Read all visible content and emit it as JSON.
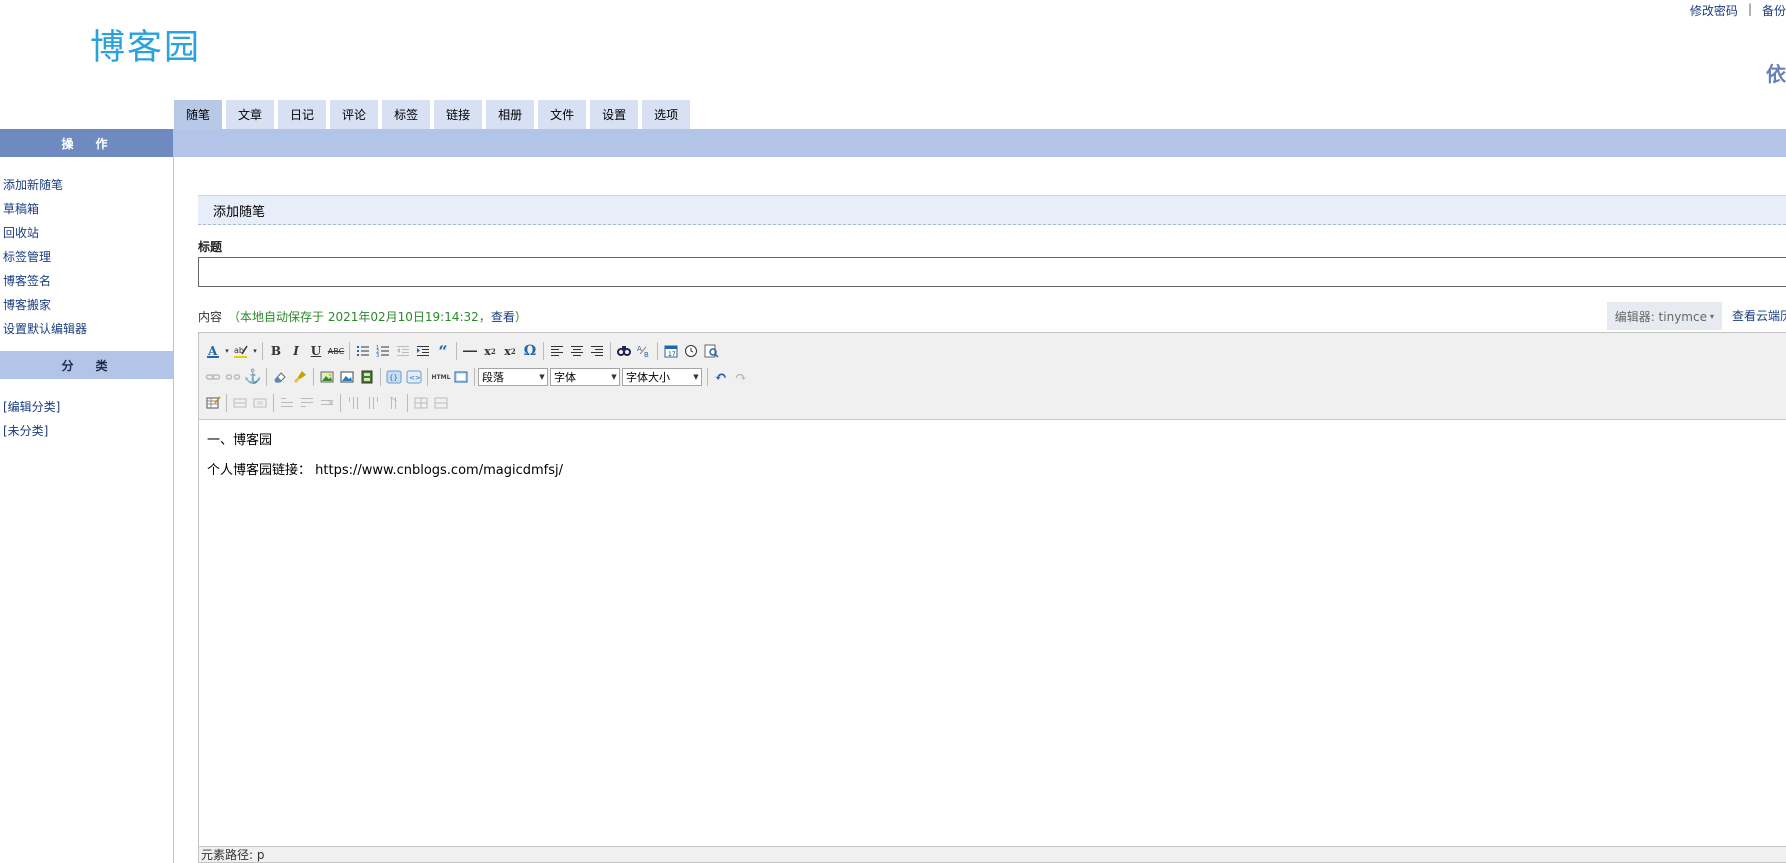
{
  "header": {
    "logo_text": "博客园",
    "top_links": [
      "修改密码",
      "备份"
    ],
    "top_sep": "|",
    "user_char": "依"
  },
  "tabs": [
    {
      "label": "随笔",
      "active": true
    },
    {
      "label": "文章"
    },
    {
      "label": "日记"
    },
    {
      "label": "评论"
    },
    {
      "label": "标签"
    },
    {
      "label": "链接"
    },
    {
      "label": "相册"
    },
    {
      "label": "文件"
    },
    {
      "label": "设置"
    },
    {
      "label": "选项"
    }
  ],
  "sidebar": {
    "ops_title": "操作",
    "ops_items": [
      "添加新随笔",
      "草稿箱",
      "回收站",
      "标签管理",
      "博客签名",
      "博客搬家",
      "设置默认编辑器"
    ],
    "cat_title": "分类",
    "cat_items": [
      "[编辑分类]",
      "[未分类]"
    ]
  },
  "main": {
    "section_title": "添加随笔",
    "title_label": "标题",
    "title_value": "",
    "content_label": "内容",
    "autosave_text": "（本地自动保存于 2021年02月10日19:14:32，",
    "autosave_view": "查看",
    "autosave_close": "）",
    "editor_switch": "编辑器: tinymce",
    "cloud_link": "查看云端历史"
  },
  "toolbar": {
    "select_paragraph": "段落",
    "select_font": "字体",
    "select_size": "字体大小",
    "html_label": "HTML"
  },
  "editor_content": {
    "line1": "一、博客园",
    "line2": "个人博客园链接： https://www.cnblogs.com/magicdmfsj/"
  },
  "status": {
    "path_label": "元素路径: p"
  },
  "colors": {
    "logo": "#2aa3dd",
    "link": "#1a3d80",
    "tab": "#d7e1f3",
    "tab_bar": "#b2c5e8",
    "side_head": "#6e8ac1",
    "autosave": "#2a8a2a"
  }
}
